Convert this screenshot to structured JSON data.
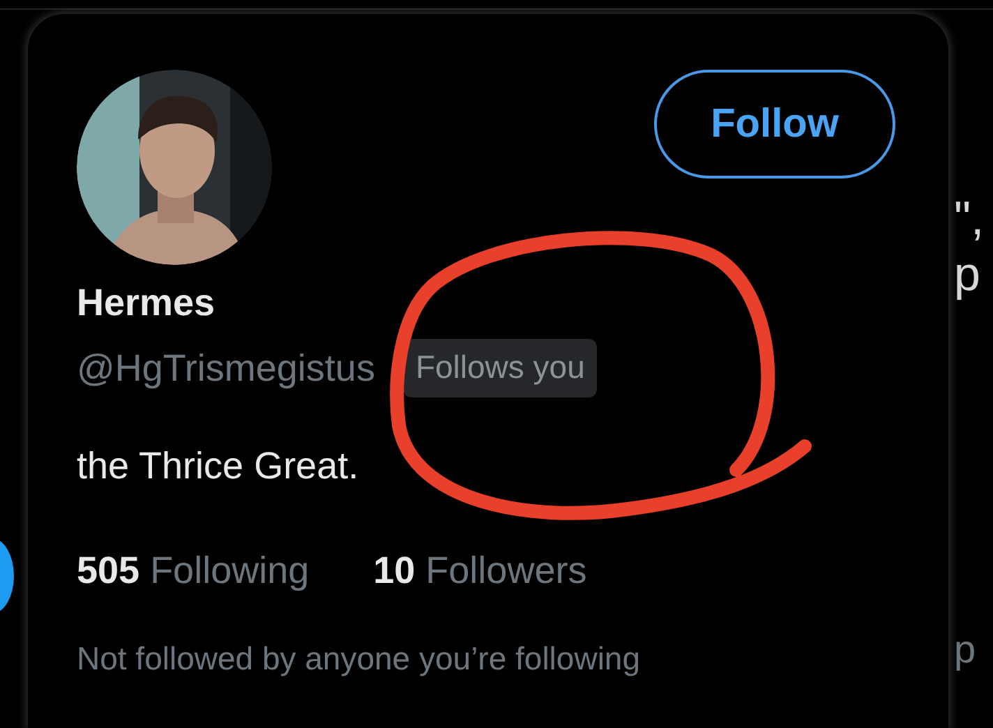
{
  "background": {
    "fragments": [
      {
        "text": "\",",
        "kind": "bright"
      },
      {
        "text": "p",
        "kind": "bright"
      },
      {
        "text": "p",
        "kind": "dim"
      }
    ]
  },
  "card": {
    "follow_button": {
      "label": "Follow"
    },
    "name": "Hermes",
    "handle": "@HgTrismegistus",
    "follows_you": {
      "label": "Follows you"
    },
    "bio": "the Thrice Great.",
    "stats": [
      {
        "count": "505",
        "label": "Following"
      },
      {
        "count": "10",
        "label": "Followers"
      }
    ],
    "footer": "Not followed by anyone you’re following"
  },
  "annotation": {
    "kind": "circle"
  }
}
